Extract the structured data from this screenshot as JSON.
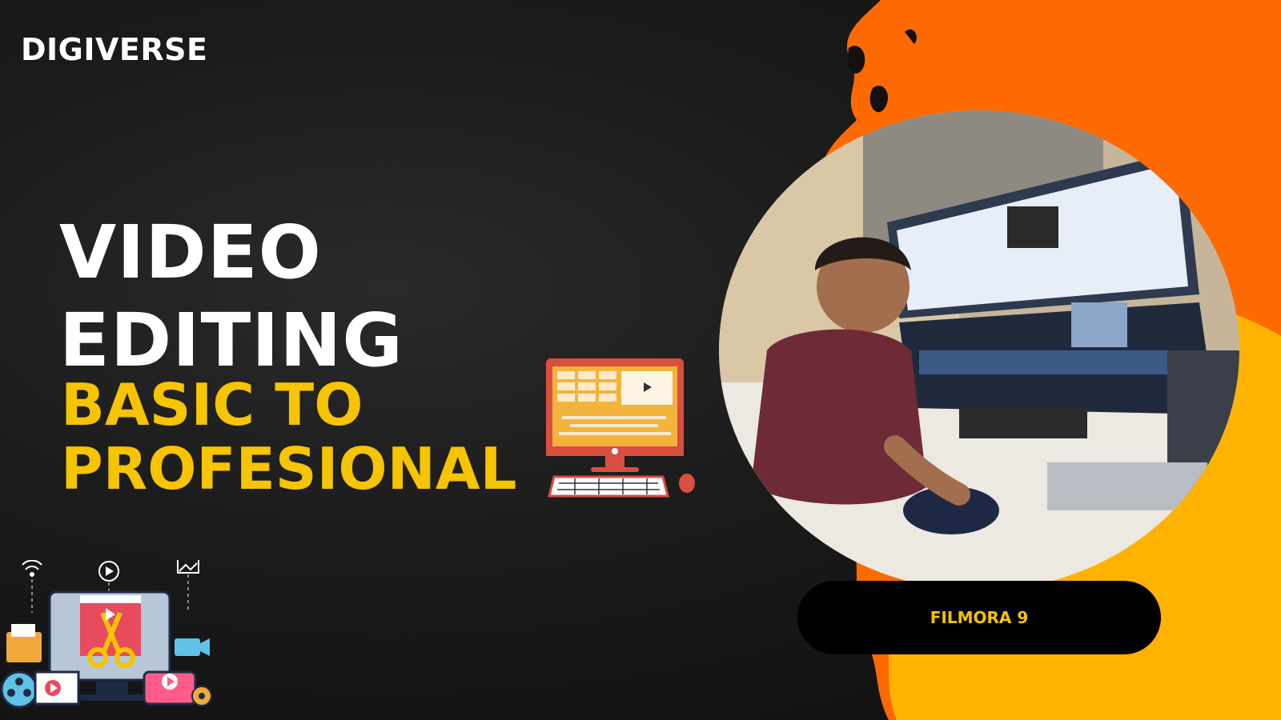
{
  "brand": {
    "name": "DIGIVERSE"
  },
  "headline": {
    "line1": "VIDEO",
    "line2": "EDITING"
  },
  "subheadline": {
    "line1": "BASIC TO",
    "line2": "PROFESIONAL"
  },
  "software_badge": {
    "label": "FILMORA 9"
  },
  "colors": {
    "background": "#141414",
    "headline": "#ffffff",
    "accent_yellow": "#f6c400",
    "accent_orange": "#ff6a00",
    "pill": "#000000"
  },
  "icons": [
    "computer-editing-icon",
    "video-editing-cluster-icon",
    "wifi-icon",
    "play-icon",
    "image-icon",
    "scissors-icon",
    "folder-icon",
    "camera-icon",
    "film-reel-icon",
    "gear-icon"
  ]
}
